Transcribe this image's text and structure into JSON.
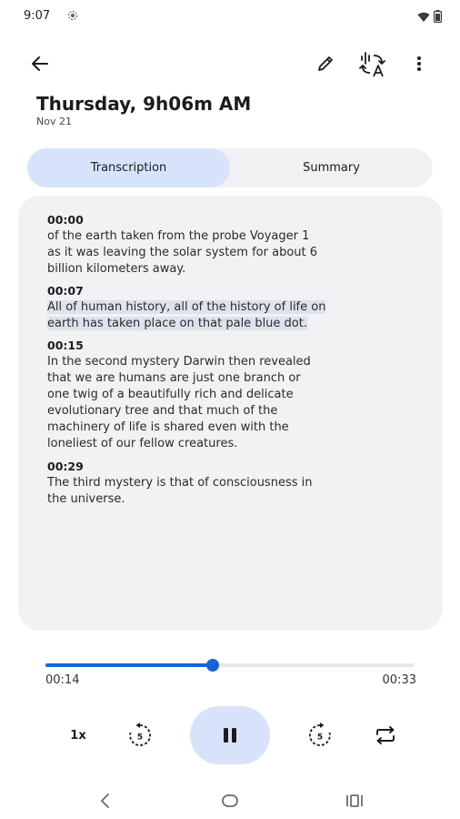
{
  "status": {
    "time": "9:07",
    "extra_icon": "settings-dot-icon"
  },
  "header": {
    "title": "Thursday, 9h06m AM",
    "date": "Nov 21",
    "icons": [
      "back-arrow-icon",
      "edit-pencil-icon",
      "translate-icon",
      "more-vert-icon"
    ]
  },
  "tabs": [
    {
      "label": "Transcription",
      "active": true
    },
    {
      "label": "Summary",
      "active": false
    }
  ],
  "transcript": [
    {
      "time": "00:00",
      "lines": [
        "of the earth taken from the probe Voyager 1",
        "as it was leaving the solar system for about 6",
        "billion kilometers away."
      ]
    },
    {
      "time": "00:07",
      "lines": [
        "All of human history, all of the history of life on",
        "earth has taken place on that pale blue dot."
      ],
      "highlighted": true
    },
    {
      "time": "00:15",
      "lines": [
        "In the second mystery Darwin then revealed",
        "that we are humans are just one branch or",
        "one twig of a beautifully rich and delicate",
        "evolutionary tree and that much of the",
        "machinery of life is shared even with the",
        "loneliest of our fellow creatures."
      ]
    },
    {
      "time": "00:29",
      "lines": [
        "The third mystery is that of consciousness in",
        "the universe."
      ]
    }
  ],
  "player": {
    "elapsed": "00:14",
    "total": "00:33",
    "progress_fraction": 0.454,
    "speed_label": "1x",
    "rewind_seconds": "5",
    "forward_seconds": "5",
    "accent_color": "#1a63d6",
    "play_state": "playing"
  },
  "nav": {
    "icons": [
      "nav-back-icon",
      "nav-home-icon",
      "nav-recents-icon"
    ]
  }
}
